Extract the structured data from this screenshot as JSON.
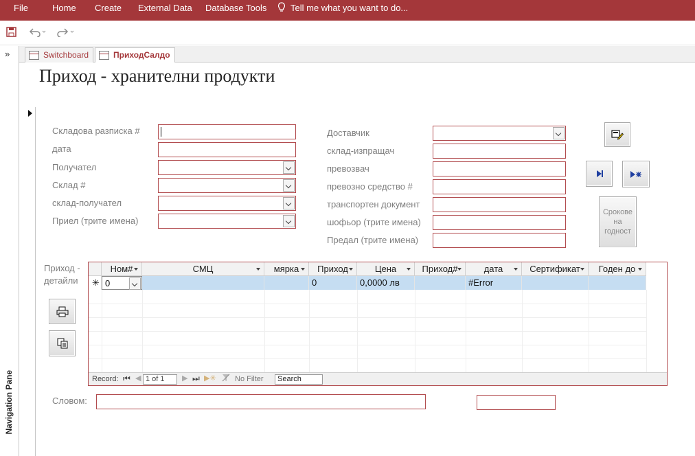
{
  "ribbon": {
    "tabs": [
      "File",
      "Home",
      "Create",
      "External Data",
      "Database Tools"
    ],
    "tell_me": "Tell me what you want to do...",
    "accent": "#a4373a"
  },
  "nav_pane": {
    "label": "Navigation Pane",
    "toggle": "»"
  },
  "doc_tabs": [
    "Switchboard",
    "ПриходСалдо"
  ],
  "form": {
    "title": "Приход - хранителни продукти",
    "left_labels": [
      "Складова разписка #",
      "дата",
      "Получател",
      "Склад #",
      "склад-получател",
      "Приел (трите имена)"
    ],
    "right_labels": [
      "Доставчик",
      "склад-изпращач",
      "превозвач",
      "превозно средство #",
      "транспортен документ",
      "шофьор (трите имена)",
      "Предал (трите имена)"
    ],
    "buttons": {
      "srokove": [
        "Срокове",
        "на",
        "годност"
      ]
    },
    "subform_label": [
      "Приход -",
      "детайли"
    ],
    "slovom_label": "Словом:"
  },
  "subform": {
    "columns": [
      "Ном#",
      "СМЦ",
      "мярка",
      "Приход",
      "Цена",
      "Приход#",
      "дата",
      "Сертификат",
      "Годен до"
    ],
    "new_row": {
      "marker": "✳",
      "values": [
        "0",
        "",
        "",
        "0",
        "0,0000 лв",
        "",
        "#Error",
        "",
        ""
      ]
    },
    "nav": {
      "record_label": "Record:",
      "position": "1 of 1",
      "filter": "No Filter",
      "search": "Search"
    }
  }
}
